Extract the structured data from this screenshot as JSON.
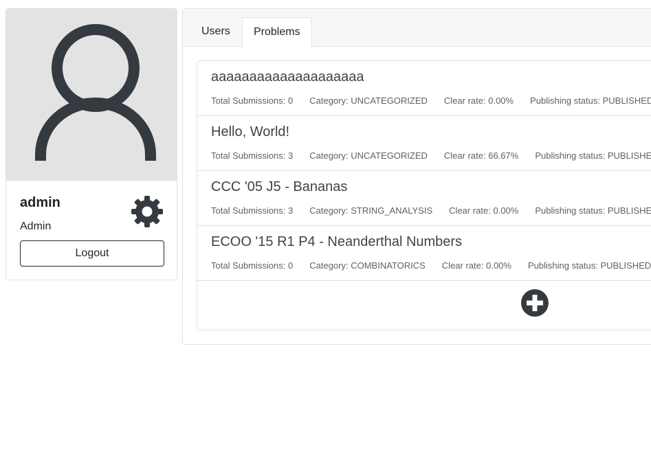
{
  "profile": {
    "username": "admin",
    "role": "Admin",
    "logout_label": "Logout"
  },
  "tabs": [
    {
      "label": "Users",
      "active": false
    },
    {
      "label": "Problems",
      "active": true
    }
  ],
  "problems": [
    {
      "title": "aaaaaaaaaaaaaaaaaaaa",
      "total_submissions": "Total Submissions: 0",
      "category": "Category: UNCATEGORIZED",
      "clear_rate": "Clear rate: 0.00%",
      "publishing_status": "Publishing status: PUBLISHED"
    },
    {
      "title": "Hello, World!",
      "total_submissions": "Total Submissions: 3",
      "category": "Category: UNCATEGORIZED",
      "clear_rate": "Clear rate: 66.67%",
      "publishing_status": "Publishing status: PUBLISHED"
    },
    {
      "title": "CCC '05 J5 - Bananas",
      "total_submissions": "Total Submissions: 3",
      "category": "Category: STRING_ANALYSIS",
      "clear_rate": "Clear rate: 0.00%",
      "publishing_status": "Publishing status: PUBLISHED"
    },
    {
      "title": "ECOO '15 R1 P4 - Neanderthal Numbers",
      "total_submissions": "Total Submissions: 0",
      "category": "Category: COMBINATORICS",
      "clear_rate": "Clear rate: 0.00%",
      "publishing_status": "Publishing status: PUBLISHED"
    }
  ],
  "icons": {
    "avatar": "user-avatar-icon",
    "settings": "gear-icon",
    "add": "plus-circle-icon"
  },
  "colors": {
    "icon_dark": "#343a40",
    "avatar_bg": "#e3e3e3"
  }
}
